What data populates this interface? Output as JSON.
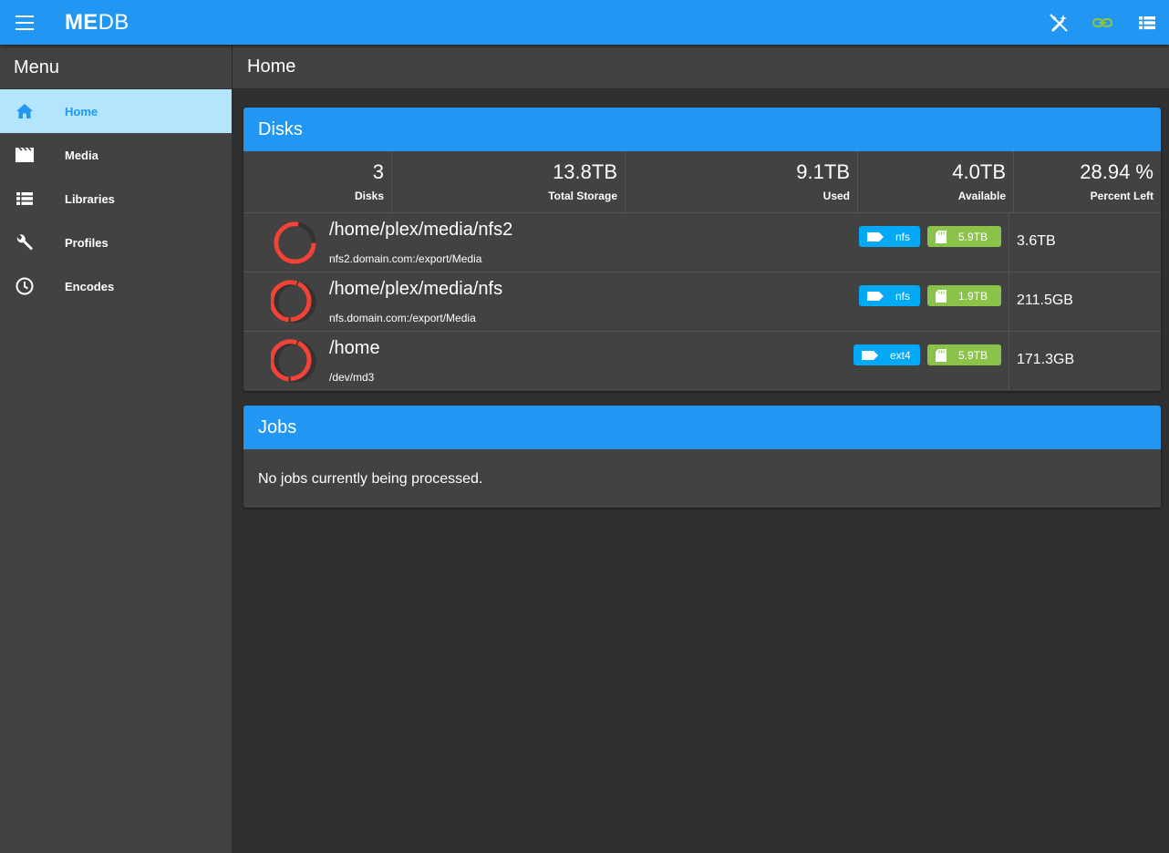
{
  "app": {
    "brand_bold": "ME",
    "brand_light": "DB"
  },
  "toolbar_icons": [
    "magic-wand-off-icon",
    "link-icon",
    "list-view-icon"
  ],
  "sidebar": {
    "title": "Menu",
    "items": [
      {
        "label": "Home",
        "icon": "home-icon",
        "active": true
      },
      {
        "label": "Media",
        "icon": "clapperboard-icon"
      },
      {
        "label": "Libraries",
        "icon": "list-icon"
      },
      {
        "label": "Profiles",
        "icon": "wrench-icon"
      },
      {
        "label": "Encodes",
        "icon": "clock-icon"
      }
    ]
  },
  "page": {
    "title": "Home"
  },
  "disks": {
    "title": "Disks",
    "stats": [
      {
        "value": "3",
        "label": "Disks"
      },
      {
        "value": "13.8TB",
        "label": "Total Storage"
      },
      {
        "value": "9.1TB",
        "label": "Used"
      },
      {
        "value": "4.0TB",
        "label": "Available"
      },
      {
        "value": "28.94 %",
        "label": "Percent Left"
      }
    ],
    "rows": [
      {
        "path": "/home/plex/media/nfs2",
        "source": "nfs2.domain.com:/export/Media",
        "fs": "nfs",
        "size": "5.9TB",
        "free": "3.6TB"
      },
      {
        "path": "/home/plex/media/nfs",
        "source": "nfs.domain.com:/export/Media",
        "fs": "nfs",
        "size": "1.9TB",
        "free": "211.5GB"
      },
      {
        "path": "/home",
        "source": "/dev/md3",
        "fs": "ext4",
        "size": "5.9TB",
        "free": "171.3GB"
      }
    ]
  },
  "jobs": {
    "title": "Jobs",
    "empty_text": "No jobs currently being processed."
  },
  "colors": {
    "primary": "#2196f3",
    "fs_badge": "#03a9f4",
    "size_badge": "#8bc34a",
    "ring_used": "#f44336",
    "ring_track": "#333333"
  }
}
